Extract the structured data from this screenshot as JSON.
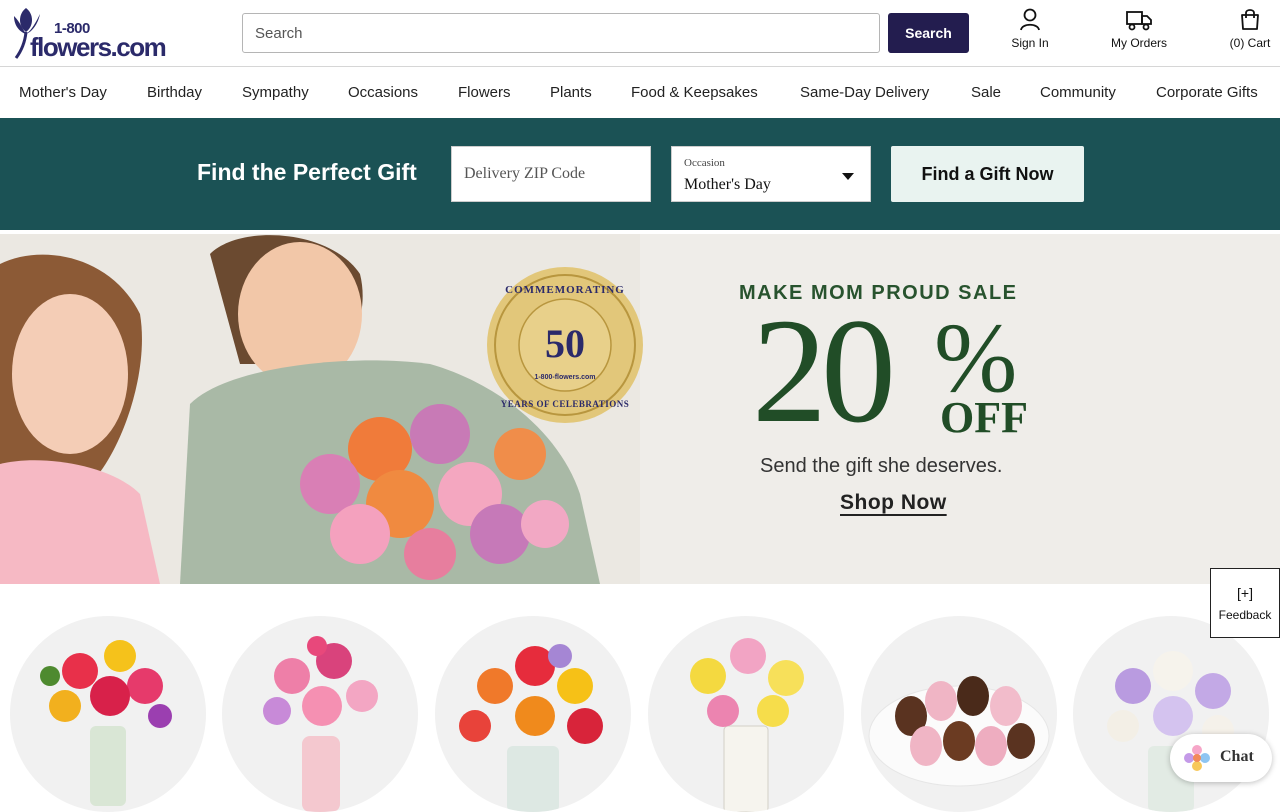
{
  "brand": {
    "logo_number": "1-800",
    "logo_word": "flowers.com",
    "colors": {
      "navy": "#231d4f",
      "teal": "#1b5255",
      "hero_green": "#214d27",
      "mint": "#e9f3f0"
    }
  },
  "header": {
    "search_placeholder": "Search",
    "search_button": "Search",
    "sign_in": "Sign In",
    "my_orders": "My Orders",
    "cart": "(0) Cart",
    "icons": {
      "sign_in": "user-icon",
      "orders": "truck-icon",
      "cart": "shopping-bag-icon"
    }
  },
  "nav": {
    "items": [
      "Mother's Day",
      "Birthday",
      "Sympathy",
      "Occasions",
      "Flowers",
      "Plants",
      "Food & Keepsakes",
      "Same-Day Delivery",
      "Sale",
      "Community",
      "Corporate Gifts"
    ]
  },
  "finder": {
    "title": "Find the Perfect Gift",
    "zip_placeholder": "Delivery ZIP Code",
    "occasion_label": "Occasion",
    "occasion_value": "Mother's Day",
    "button": "Find a Gift Now"
  },
  "hero": {
    "badge_top": "COMMEMORATING",
    "badge_number": "50",
    "badge_brand": "1-800-flowers.com",
    "badge_bottom": "YEARS OF CELEBRATIONS",
    "headline": "MAKE MOM PROUD SALE",
    "big_number": "20",
    "percent": "%",
    "off": "OFF",
    "subtext": "Send the gift she deserves.",
    "cta": "Shop Now"
  },
  "products": {
    "images": [
      "bouquet-image",
      "bouquet-image",
      "bouquet-image",
      "lily-bouquet-image",
      "strawberries-image",
      "bouquet-image"
    ]
  },
  "feedback": {
    "plus": "[+]",
    "label": "Feedback"
  },
  "chat": {
    "label": "Chat"
  }
}
